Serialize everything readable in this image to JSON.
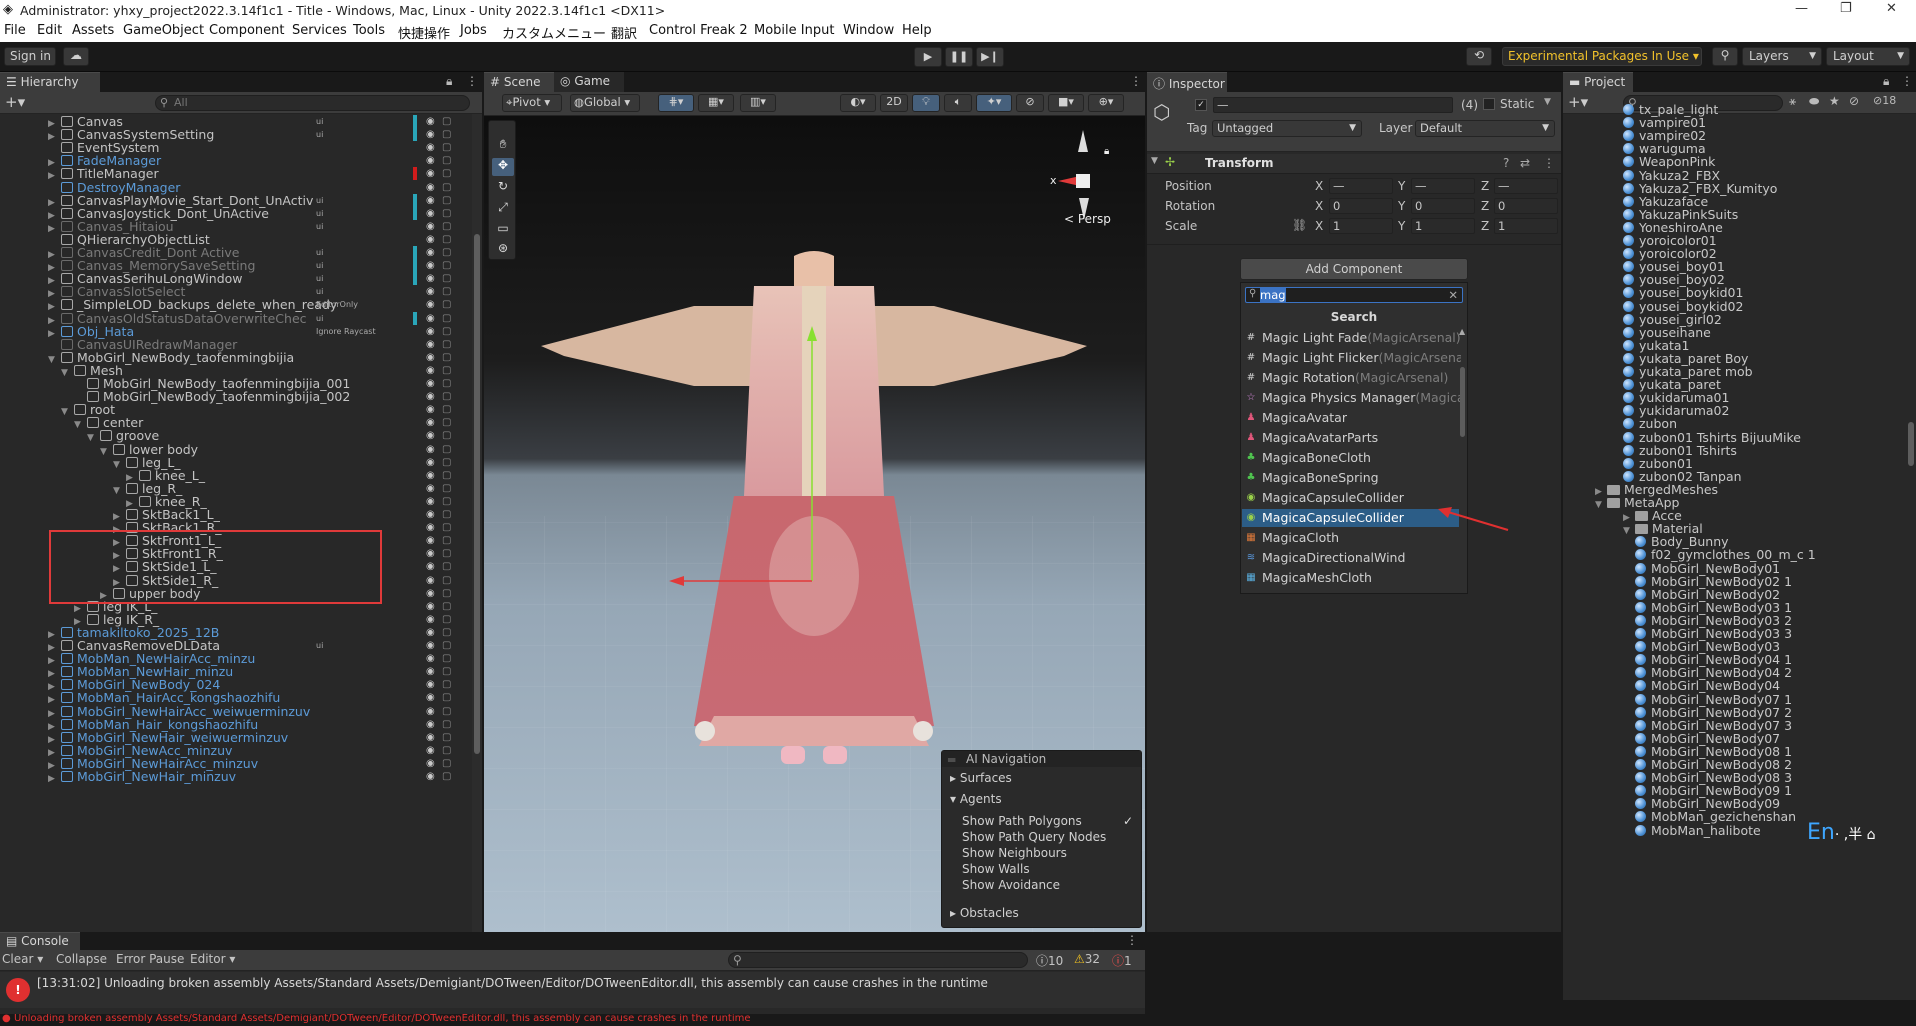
{
  "window": {
    "title": "Administrator: yhxy_project2022.3.14f1c1 - Title - Windows, Mac, Linux - Unity 2022.3.14f1c1 <DX11>",
    "minimize": "—",
    "maximize": "❐",
    "close": "✕"
  },
  "menu": [
    "File",
    "Edit",
    "Assets",
    "GameObject",
    "Component",
    "Services",
    "Tools",
    "快捷操作",
    "Jobs",
    "カスタムメニュー",
    "翻訳",
    "Control Freak 2",
    "Mobile Input",
    "Window",
    "Help"
  ],
  "toolbar": {
    "sign_in": "Sign in",
    "experimental": "Experimental Packages In Use ▾",
    "layers": "Layers",
    "layout": "Layout"
  },
  "hierarchy": {
    "tab": "Hierarchy",
    "search_placeholder": "All",
    "rows": [
      {
        "label": "Canvas",
        "indent": 0,
        "arrow": "▶",
        "type": "normal",
        "tag": "ui",
        "marker": "#2aa6b9"
      },
      {
        "label": "CanvasSystemSetting",
        "indent": 0,
        "arrow": "▶",
        "type": "normal",
        "tag": "ui",
        "marker": "#2aa6b9"
      },
      {
        "label": "EventSystem",
        "indent": 0,
        "arrow": "",
        "type": "normal",
        "tag": "",
        "marker": ""
      },
      {
        "label": "FadeManager",
        "indent": 0,
        "arrow": "▶",
        "type": "prefab",
        "tag": "",
        "marker": ""
      },
      {
        "label": "TitleManager",
        "indent": 0,
        "arrow": "▶",
        "type": "normal",
        "tag": "",
        "marker": "#d21c1c"
      },
      {
        "label": "DestroyManager",
        "indent": 0,
        "arrow": "",
        "type": "prefab",
        "tag": "",
        "marker": ""
      },
      {
        "label": "CanvasPlayMovie_Start_Dont_UnActiv",
        "indent": 0,
        "arrow": "▶",
        "type": "normal",
        "tag": "ui",
        "marker": "#2aa6b9"
      },
      {
        "label": "CanvasJoystick_Dont_UnActive",
        "indent": 0,
        "arrow": "▶",
        "type": "normal",
        "tag": "ui",
        "marker": "#2aa6b9"
      },
      {
        "label": "Canvas_Hitaiou",
        "indent": 0,
        "arrow": "▶",
        "type": "disabled",
        "tag": "ui",
        "marker": ""
      },
      {
        "label": "QHierarchyObjectList",
        "indent": 0,
        "arrow": "",
        "type": "normal",
        "tag": "",
        "marker": ""
      },
      {
        "label": "CanvasCredit_Dont Active",
        "indent": 0,
        "arrow": "▶",
        "type": "disabled",
        "tag": "ui",
        "marker": "#2aa6b9"
      },
      {
        "label": "Canvas_MemorySaveSetting",
        "indent": 0,
        "arrow": "▶",
        "type": "disabled",
        "tag": "ui",
        "marker": "#2aa6b9"
      },
      {
        "label": "CanvasSerihuLongWindow",
        "indent": 0,
        "arrow": "▶",
        "type": "normal",
        "tag": "ui",
        "marker": "#2aa6b9"
      },
      {
        "label": "CanvasSlotSelect",
        "indent": 0,
        "arrow": "▶",
        "type": "disabled",
        "tag": "ui",
        "marker": ""
      },
      {
        "label": "_SimpleLOD_backups_delete_when_ready",
        "indent": 0,
        "arrow": "▶",
        "type": "normal",
        "tag": "EditorOnly",
        "marker": ""
      },
      {
        "label": "CanvasOldStatusDataOverwriteChec",
        "indent": 0,
        "arrow": "▶",
        "type": "disabled",
        "tag": "ui",
        "marker": "#2aa6b9"
      },
      {
        "label": "Obj_Hata",
        "indent": 0,
        "arrow": "▶",
        "type": "prefabdis",
        "tag": "Ignore Raycast",
        "marker": ""
      },
      {
        "label": "CanvasUIRedrawManager",
        "indent": 0,
        "arrow": "",
        "type": "disabled",
        "tag": "",
        "marker": ""
      },
      {
        "label": "MobGirl_NewBody_taofenmingbijia",
        "indent": 0,
        "arrow": "▼",
        "type": "normal",
        "tag": "",
        "marker": ""
      },
      {
        "label": "Mesh",
        "indent": 1,
        "arrow": "▼",
        "type": "normal",
        "tag": "",
        "marker": ""
      },
      {
        "label": "MobGirl_NewBody_taofenmingbijia_001",
        "indent": 2,
        "arrow": "",
        "type": "normal",
        "tag": "",
        "marker": ""
      },
      {
        "label": "MobGirl_NewBody_taofenmingbijia_002",
        "indent": 2,
        "arrow": "",
        "type": "normal",
        "tag": "",
        "marker": ""
      },
      {
        "label": "root",
        "indent": 1,
        "arrow": "▼",
        "type": "normal",
        "tag": "",
        "marker": ""
      },
      {
        "label": "center",
        "indent": 2,
        "arrow": "▼",
        "type": "normal",
        "tag": "",
        "marker": ""
      },
      {
        "label": "groove",
        "indent": 3,
        "arrow": "▼",
        "type": "normal",
        "tag": "",
        "marker": ""
      },
      {
        "label": "lower body",
        "indent": 4,
        "arrow": "▼",
        "type": "normal",
        "tag": "",
        "marker": ""
      },
      {
        "label": "leg_L_",
        "indent": 5,
        "arrow": "▼",
        "type": "normal",
        "tag": "",
        "marker": ""
      },
      {
        "label": "knee_L_",
        "indent": 6,
        "arrow": "▶",
        "type": "normal",
        "tag": "",
        "marker": ""
      },
      {
        "label": "leg_R_",
        "indent": 5,
        "arrow": "▼",
        "type": "normal",
        "tag": "",
        "marker": ""
      },
      {
        "label": "knee_R_",
        "indent": 6,
        "arrow": "▶",
        "type": "normal",
        "tag": "",
        "marker": ""
      },
      {
        "label": "SktBack1_L_",
        "indent": 5,
        "arrow": "▶",
        "type": "normal",
        "tag": "",
        "marker": ""
      },
      {
        "label": "SktBack1_R_",
        "indent": 5,
        "arrow": "▶",
        "type": "normal",
        "tag": "",
        "marker": ""
      },
      {
        "label": "SktFront1_L_",
        "indent": 5,
        "arrow": "▶",
        "type": "normal",
        "tag": "",
        "marker": ""
      },
      {
        "label": "SktFront1_R_",
        "indent": 5,
        "arrow": "▶",
        "type": "normal",
        "tag": "",
        "marker": ""
      },
      {
        "label": "SktSide1_L_",
        "indent": 5,
        "arrow": "▶",
        "type": "normal",
        "tag": "",
        "marker": ""
      },
      {
        "label": "SktSide1_R_",
        "indent": 5,
        "arrow": "▶",
        "type": "normal",
        "tag": "",
        "marker": ""
      },
      {
        "label": "upper body",
        "indent": 4,
        "arrow": "▶",
        "type": "normal",
        "tag": "",
        "marker": ""
      },
      {
        "label": "leg IK_L_",
        "indent": 2,
        "arrow": "▶",
        "type": "normal",
        "tag": "",
        "marker": ""
      },
      {
        "label": "leg IK_R_",
        "indent": 2,
        "arrow": "▶",
        "type": "normal",
        "tag": "",
        "marker": ""
      },
      {
        "label": "tamakiltoko_2025_12B",
        "indent": 0,
        "arrow": "▶",
        "type": "prefab",
        "tag": "",
        "marker": ""
      },
      {
        "label": "CanvasRemoveDLData",
        "indent": 0,
        "arrow": "▶",
        "type": "normal",
        "tag": "ui",
        "marker": ""
      },
      {
        "label": "MobMan_NewHairAcc_minzu",
        "indent": 0,
        "arrow": "▶",
        "type": "prefab",
        "tag": "",
        "marker": ""
      },
      {
        "label": "MobMan_NewHair_minzu",
        "indent": 0,
        "arrow": "▶",
        "type": "prefab",
        "tag": "",
        "marker": ""
      },
      {
        "label": "MobGirl_NewBody_024",
        "indent": 0,
        "arrow": "▶",
        "type": "prefab",
        "tag": "",
        "marker": ""
      },
      {
        "label": "MobMan_HairAcc_kongshaozhifu",
        "indent": 0,
        "arrow": "▶",
        "type": "prefab",
        "tag": "",
        "marker": ""
      },
      {
        "label": "MobGirl_NewHairAcc_weiwuerminzuv",
        "indent": 0,
        "arrow": "▶",
        "type": "prefab",
        "tag": "",
        "marker": ""
      },
      {
        "label": "MobMan_Hair_kongshaozhifu",
        "indent": 0,
        "arrow": "▶",
        "type": "prefab",
        "tag": "",
        "marker": ""
      },
      {
        "label": "MobGirl_NewHair_weiwuerminzuv",
        "indent": 0,
        "arrow": "▶",
        "type": "prefab",
        "tag": "",
        "marker": ""
      },
      {
        "label": "MobGirl_NewAcc_minzuv",
        "indent": 0,
        "arrow": "▶",
        "type": "prefab",
        "tag": "",
        "marker": ""
      },
      {
        "label": "MobGirl_NewHairAcc_minzuv",
        "indent": 0,
        "arrow": "▶",
        "type": "prefab",
        "tag": "",
        "marker": ""
      },
      {
        "label": "MobGirl_NewHair_minzuv",
        "indent": 0,
        "arrow": "▶",
        "type": "prefab",
        "tag": "",
        "marker": ""
      }
    ]
  },
  "scene": {
    "tab_scene": "Scene",
    "tab_game": "Game",
    "pivot": "Pivot",
    "global": "Global",
    "twod": "2D",
    "persp": "< Persp",
    "gizmo_x": "x"
  },
  "ainav": {
    "title": "AI Navigation",
    "surfaces": "Surfaces",
    "agents": "Agents",
    "items": [
      "Show Path Polygons",
      "Show Path Query Nodes",
      "Show Neighbours",
      "Show Walls",
      "Show Avoidance"
    ],
    "checked": [
      true,
      false,
      false,
      false,
      false
    ],
    "obstacles": "Obstacles"
  },
  "inspector": {
    "tab": "Inspector",
    "name": "—",
    "count": "(4)",
    "static": "Static",
    "tag_label": "Tag",
    "tag_value": "Untagged",
    "layer_label": "Layer",
    "layer_value": "Default",
    "transform": "Transform",
    "position": {
      "label": "Position",
      "x": "—",
      "y": "—",
      "z": "—"
    },
    "rotation": {
      "label": "Rotation",
      "x": "0",
      "y": "0",
      "z": "0"
    },
    "scale": {
      "label": "Scale",
      "x": "1",
      "y": "1",
      "z": "1"
    },
    "axis_x": "X",
    "axis_y": "Y",
    "axis_z": "Z",
    "add_component": "Add Component",
    "search_value": "mag",
    "search_title": "Search",
    "components": [
      {
        "name": "Magic Light Fade",
        "pkg": "(MagicArsenal)",
        "icon": "#",
        "color": "#cfcfcf"
      },
      {
        "name": "Magic Light Flicker",
        "pkg": "(MagicArsenal)",
        "icon": "#",
        "color": "#cfcfcf"
      },
      {
        "name": "Magic Rotation",
        "pkg": "(MagicArsenal)",
        "icon": "#",
        "color": "#cfcfcf"
      },
      {
        "name": "Magica Physics Manager",
        "pkg": "(MagicaC",
        "icon": "☆",
        "color": "#d98adf"
      },
      {
        "name": "MagicaAvatar",
        "pkg": "",
        "icon": "♟",
        "color": "#e0567a"
      },
      {
        "name": "MagicaAvatarParts",
        "pkg": "",
        "icon": "♟",
        "color": "#e0567a"
      },
      {
        "name": "MagicaBoneCloth",
        "pkg": "",
        "icon": "♣",
        "color": "#4fc34f"
      },
      {
        "name": "MagicaBoneSpring",
        "pkg": "",
        "icon": "♣",
        "color": "#4fc34f"
      },
      {
        "name": "MagicaCapsuleCollider",
        "pkg": "",
        "icon": "◉",
        "color": "#9ad14a"
      },
      {
        "name": "MagicaCapsuleCollider",
        "pkg": "",
        "icon": "◉",
        "color": "#9ad14a",
        "selected": true
      },
      {
        "name": "MagicaCloth",
        "pkg": "",
        "icon": "▦",
        "color": "#e07a3a"
      },
      {
        "name": "MagicaDirectionalWind",
        "pkg": "",
        "icon": "≋",
        "color": "#5a9ae0"
      },
      {
        "name": "MagicaMeshCloth",
        "pkg": "",
        "icon": "▦",
        "color": "#5ab0e0"
      }
    ]
  },
  "project": {
    "tab": "Project",
    "count": "18",
    "items": [
      {
        "label": "tx_pale_light",
        "indent": 0,
        "kind": "mat"
      },
      {
        "label": "vampire01",
        "indent": 0,
        "kind": "mat"
      },
      {
        "label": "vampire02",
        "indent": 0,
        "kind": "mat"
      },
      {
        "label": "waruguma",
        "indent": 0,
        "kind": "mat"
      },
      {
        "label": "WeaponPink",
        "indent": 0,
        "kind": "mat"
      },
      {
        "label": "Yakuza2_FBX",
        "indent": 0,
        "kind": "mat"
      },
      {
        "label": "Yakuza2_FBX_Kumityo",
        "indent": 0,
        "kind": "mat"
      },
      {
        "label": "Yakuzaface",
        "indent": 0,
        "kind": "mat"
      },
      {
        "label": "YakuzaPinkSuits",
        "indent": 0,
        "kind": "mat"
      },
      {
        "label": "YoneshiroAne",
        "indent": 0,
        "kind": "mat"
      },
      {
        "label": "yoroicolor01",
        "indent": 0,
        "kind": "mat"
      },
      {
        "label": "yoroicolor02",
        "indent": 0,
        "kind": "mat"
      },
      {
        "label": "yousei_boy01",
        "indent": 0,
        "kind": "mat"
      },
      {
        "label": "yousei_boy02",
        "indent": 0,
        "kind": "mat"
      },
      {
        "label": "yousei_boykid01",
        "indent": 0,
        "kind": "mat"
      },
      {
        "label": "yousei_boykid02",
        "indent": 0,
        "kind": "mat"
      },
      {
        "label": "yousei_girl02",
        "indent": 0,
        "kind": "mat"
      },
      {
        "label": "youseihane",
        "indent": 0,
        "kind": "mat"
      },
      {
        "label": "yukata1",
        "indent": 0,
        "kind": "mat"
      },
      {
        "label": "yukata_paret Boy",
        "indent": 0,
        "kind": "mat"
      },
      {
        "label": "yukata_paret mob",
        "indent": 0,
        "kind": "mat"
      },
      {
        "label": "yukata_paret",
        "indent": 0,
        "kind": "mat"
      },
      {
        "label": "yukidaruma01",
        "indent": 0,
        "kind": "mat"
      },
      {
        "label": "yukidaruma02",
        "indent": 0,
        "kind": "mat"
      },
      {
        "label": "zubon",
        "indent": 0,
        "kind": "mat"
      },
      {
        "label": "zubon01 Tshirts BijuuMike",
        "indent": 0,
        "kind": "mat"
      },
      {
        "label": "zubon01 Tshirts",
        "indent": 0,
        "kind": "mat"
      },
      {
        "label": "zubon01",
        "indent": 0,
        "kind": "mat"
      },
      {
        "label": "zubon02 Tanpan",
        "indent": 0,
        "kind": "mat"
      },
      {
        "label": "MergedMeshes",
        "indent": -1,
        "kind": "folder",
        "arrow": "▶"
      },
      {
        "label": "MetaApp",
        "indent": -1,
        "kind": "folder",
        "arrow": "▼"
      },
      {
        "label": "Acce",
        "indent": 0,
        "kind": "folder",
        "arrow": "▶"
      },
      {
        "label": "Material",
        "indent": 0,
        "kind": "folder",
        "arrow": "▼"
      },
      {
        "label": "Body_Bunny",
        "indent": 1,
        "kind": "mat"
      },
      {
        "label": "f02_gymclothes_00_m_c 1",
        "indent": 1,
        "kind": "mat"
      },
      {
        "label": "MobGirl_NewBody01",
        "indent": 1,
        "kind": "mat"
      },
      {
        "label": "MobGirl_NewBody02 1",
        "indent": 1,
        "kind": "mat"
      },
      {
        "label": "MobGirl_NewBody02",
        "indent": 1,
        "kind": "mat"
      },
      {
        "label": "MobGirl_NewBody03 1",
        "indent": 1,
        "kind": "mat"
      },
      {
        "label": "MobGirl_NewBody03 2",
        "indent": 1,
        "kind": "mat"
      },
      {
        "label": "MobGirl_NewBody03 3",
        "indent": 1,
        "kind": "mat"
      },
      {
        "label": "MobGirl_NewBody03",
        "indent": 1,
        "kind": "mat"
      },
      {
        "label": "MobGirl_NewBody04 1",
        "indent": 1,
        "kind": "mat"
      },
      {
        "label": "MobGirl_NewBody04 2",
        "indent": 1,
        "kind": "mat"
      },
      {
        "label": "MobGirl_NewBody04",
        "indent": 1,
        "kind": "mat"
      },
      {
        "label": "MobGirl_NewBody07 1",
        "indent": 1,
        "kind": "mat"
      },
      {
        "label": "MobGirl_NewBody07 2",
        "indent": 1,
        "kind": "mat"
      },
      {
        "label": "MobGirl_NewBody07 3",
        "indent": 1,
        "kind": "mat"
      },
      {
        "label": "MobGirl_NewBody07",
        "indent": 1,
        "kind": "mat"
      },
      {
        "label": "MobGirl_NewBody08 1",
        "indent": 1,
        "kind": "mat"
      },
      {
        "label": "MobGirl_NewBody08 2",
        "indent": 1,
        "kind": "mat"
      },
      {
        "label": "MobGirl_NewBody08 3",
        "indent": 1,
        "kind": "mat"
      },
      {
        "label": "MobGirl_NewBody09 1",
        "indent": 1,
        "kind": "mat"
      },
      {
        "label": "MobGirl_NewBody09",
        "indent": 1,
        "kind": "mat"
      },
      {
        "label": "MobMan_gezichenshan",
        "indent": 1,
        "kind": "mat"
      },
      {
        "label": "MobMan_halibote",
        "indent": 1,
        "kind": "mat"
      }
    ]
  },
  "ime": {
    "text": "En",
    "extra": "· ,半"
  },
  "console": {
    "tab": "Console",
    "clear": "Clear ▾",
    "collapse": "Collapse",
    "error_pause": "Error Pause",
    "editor": "Editor ▾",
    "info_count": "10",
    "warn_count": "32",
    "error_count": "1",
    "message": "[13:31:02] Unloading broken assembly Assets/Standard Assets/Demigiant/DOTween/Editor/DOTweenEditor.dll, this assembly can cause crashes in the runtime"
  },
  "statusbar": {
    "text": "Unloading broken assembly Assets/Standard Assets/Demigiant/DOTween/Editor/DOTweenEditor.dll, this assembly can cause crashes in the runtime"
  }
}
